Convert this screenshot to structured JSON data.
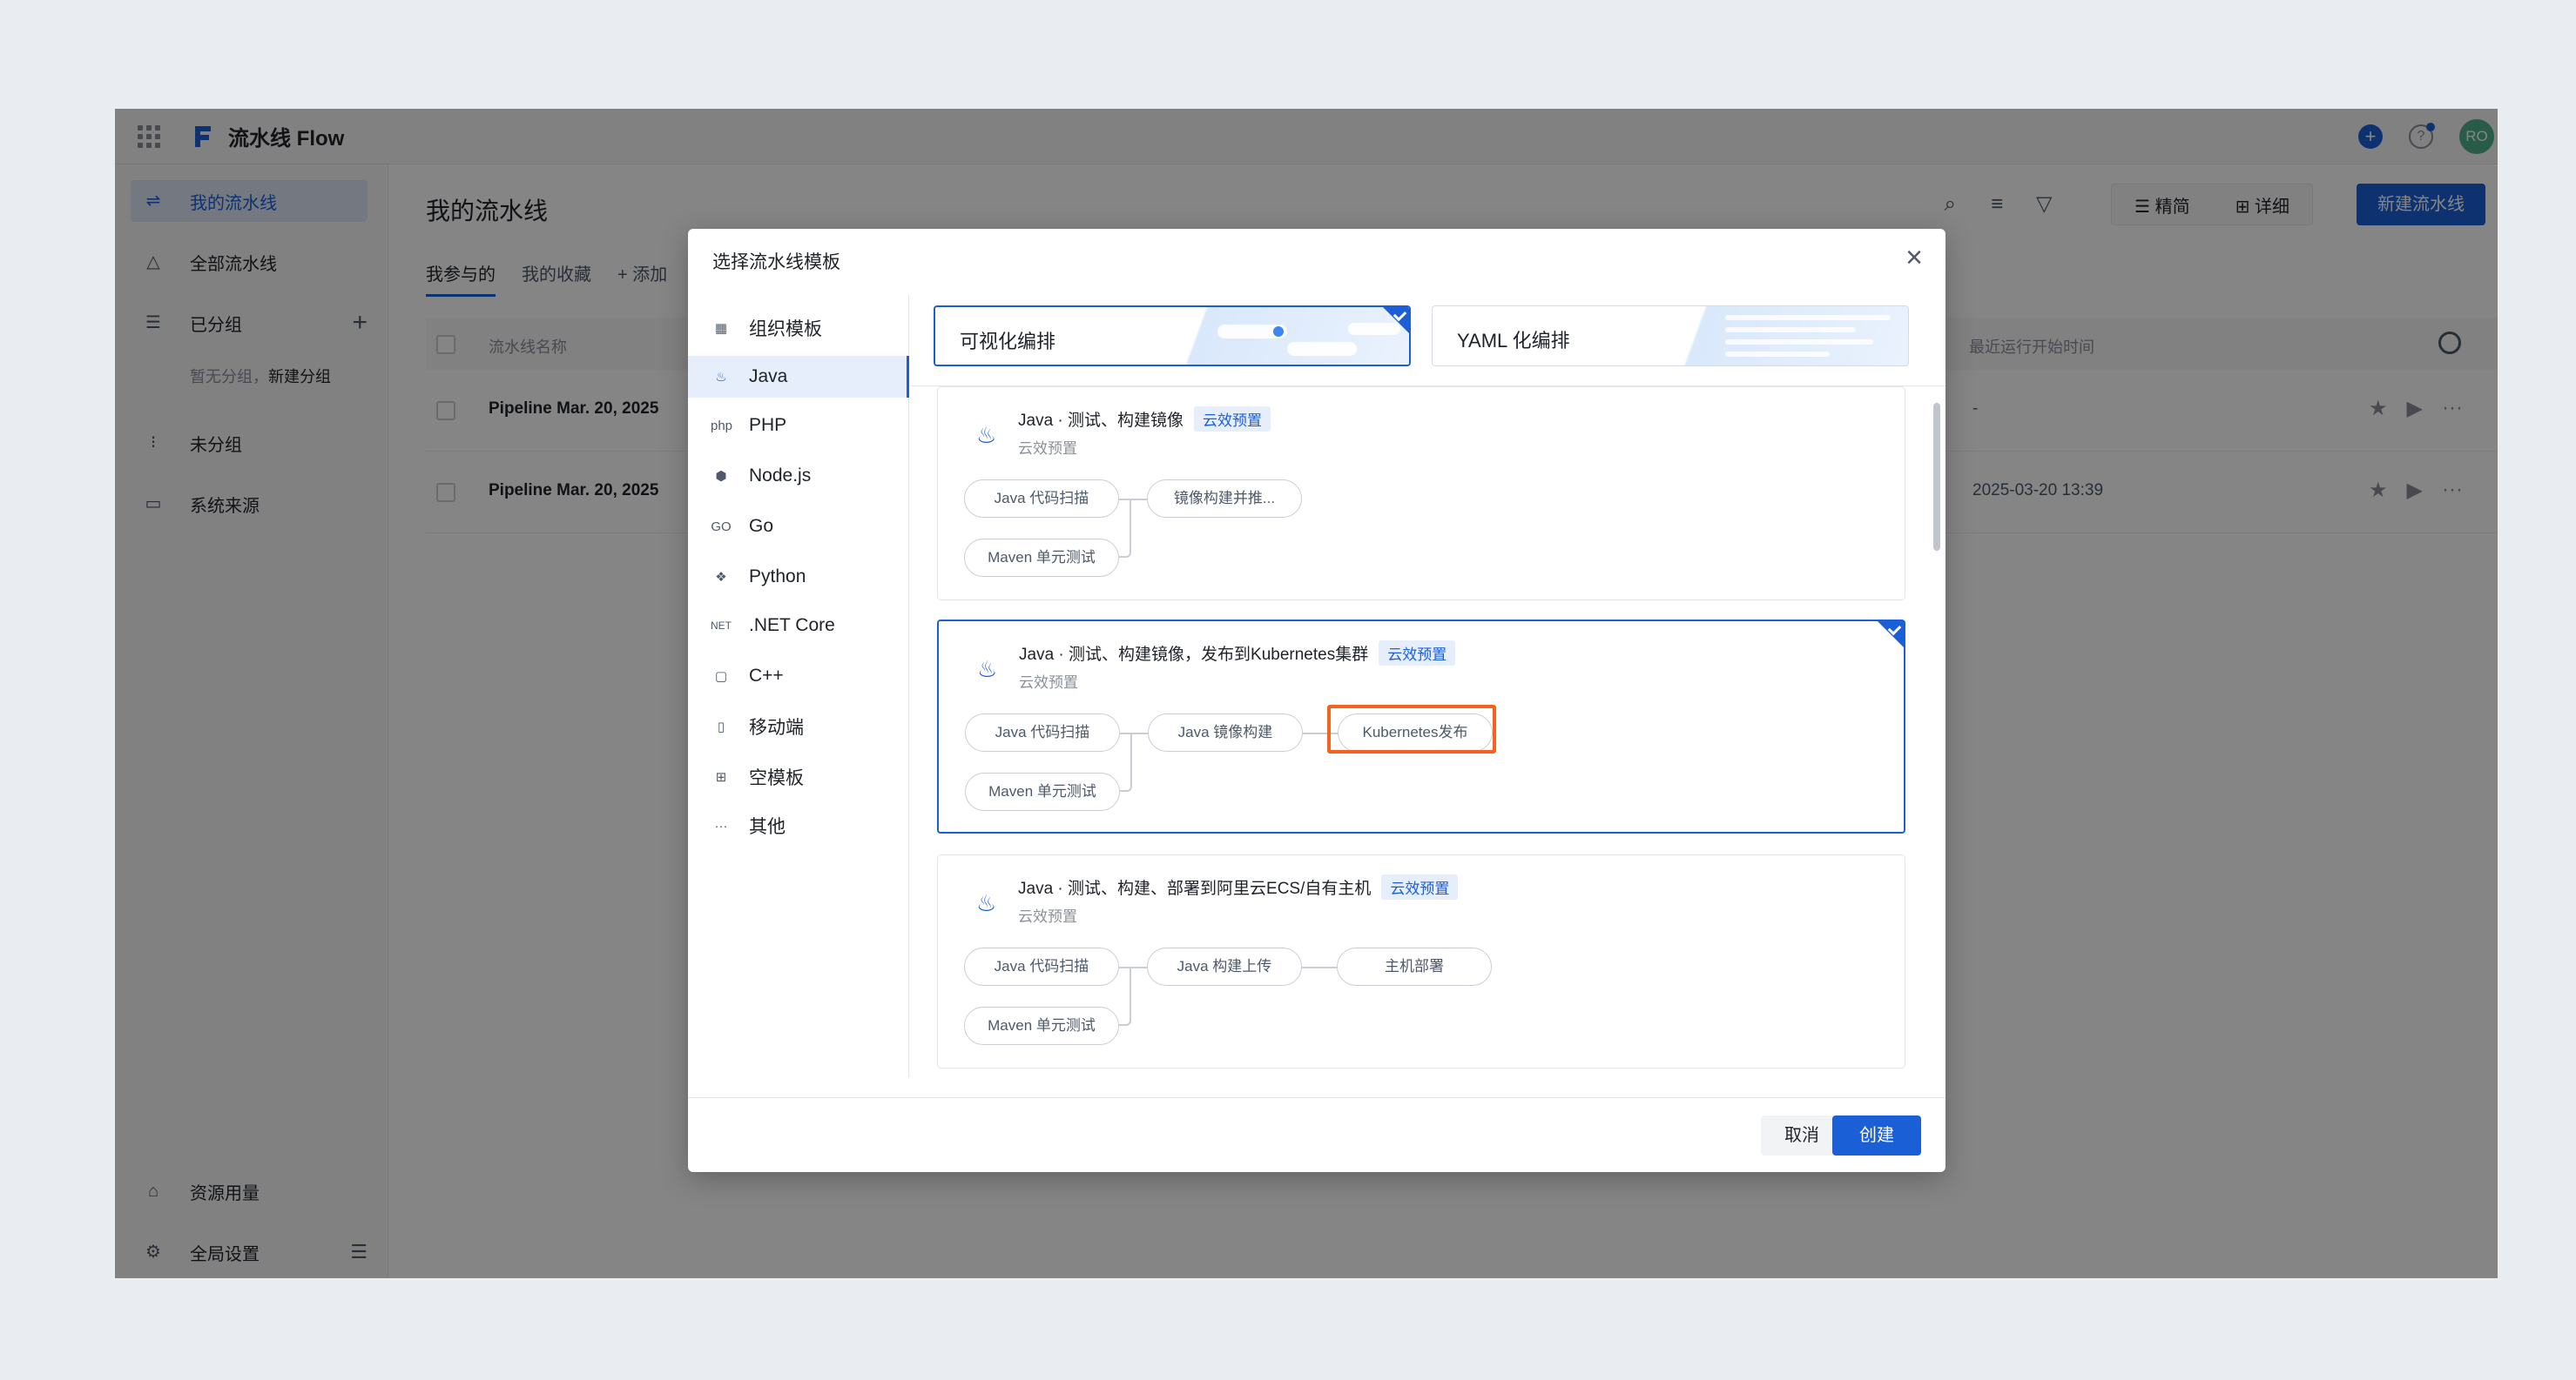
{
  "app": {
    "brand": "流水线 Flow",
    "avatar": "RO"
  },
  "sidebar": {
    "items": [
      {
        "label": "我的流水线",
        "icon": "pipeline-icon"
      },
      {
        "label": "全部流水线",
        "icon": "nodes-icon"
      },
      {
        "label": "已分组",
        "icon": "list-icon"
      },
      {
        "label": "未分组",
        "icon": "ungrouped-icon"
      },
      {
        "label": "系统来源",
        "icon": "monitor-icon"
      },
      {
        "label": "资源用量",
        "icon": "inbox-icon"
      },
      {
        "label": "全局设置",
        "icon": "gear-icon"
      }
    ],
    "group_hint": "暂无分组，",
    "group_hint_link": "新建分组"
  },
  "main": {
    "title": "我的流水线",
    "tabs": [
      "我参与的",
      "我的收藏",
      "添加"
    ],
    "view_simple": "精简",
    "view_detail": "详细",
    "new_button": "新建流水线",
    "table": {
      "col_name": "流水线名称",
      "col_time": "最近运行开始时间",
      "rows": [
        {
          "name": "Pipeline Mar. 20, 2025",
          "time": "-"
        },
        {
          "name": "Pipeline Mar. 20, 2025",
          "time": "2025-03-20 13:39"
        }
      ]
    }
  },
  "modal": {
    "title": "选择流水线模板",
    "nav": [
      {
        "label": "组织模板",
        "icon": "grid-icon",
        "glyph": "▦"
      },
      {
        "label": "Java",
        "icon": "java-icon",
        "glyph": "♨"
      },
      {
        "label": "PHP",
        "icon": "php-icon",
        "glyph": "php"
      },
      {
        "label": "Node.js",
        "icon": "nodejs-icon",
        "glyph": "⬢"
      },
      {
        "label": "Go",
        "icon": "go-icon",
        "glyph": "GO"
      },
      {
        "label": "Python",
        "icon": "python-icon",
        "glyph": "❖"
      },
      {
        "label": ".NET Core",
        "icon": "dotnet-icon",
        "glyph": "NET"
      },
      {
        "label": "C++",
        "icon": "cpp-icon",
        "glyph": "▢"
      },
      {
        "label": "移动端",
        "icon": "mobile-icon",
        "glyph": "▯"
      },
      {
        "label": "空模板",
        "icon": "blank-template-icon",
        "glyph": "⊞"
      },
      {
        "label": "其他",
        "icon": "more-icon",
        "glyph": "···"
      }
    ],
    "modes": [
      {
        "label": "可视化编排"
      },
      {
        "label": "YAML 化编排"
      }
    ],
    "templates": [
      {
        "name": "Java · 测试、构建镜像",
        "tag": "云效预置",
        "sub": "云效预置",
        "stages": [
          "Java 代码扫描",
          "Maven 单元测试",
          "镜像构建并推..."
        ]
      },
      {
        "name": "Java · 测试、构建镜像，发布到Kubernetes集群",
        "tag": "云效预置",
        "sub": "云效预置",
        "stages": [
          "Java 代码扫描",
          "Maven 单元测试",
          "Java 镜像构建",
          "Kubernetes发布"
        ]
      },
      {
        "name": "Java · 测试、构建、部署到阿里云ECS/自有主机",
        "tag": "云效预置",
        "sub": "云效预置",
        "stages": [
          "Java 代码扫描",
          "Maven 单元测试",
          "Java 构建上传",
          "主机部署"
        ]
      }
    ],
    "cancel": "取消",
    "create": "创建"
  }
}
